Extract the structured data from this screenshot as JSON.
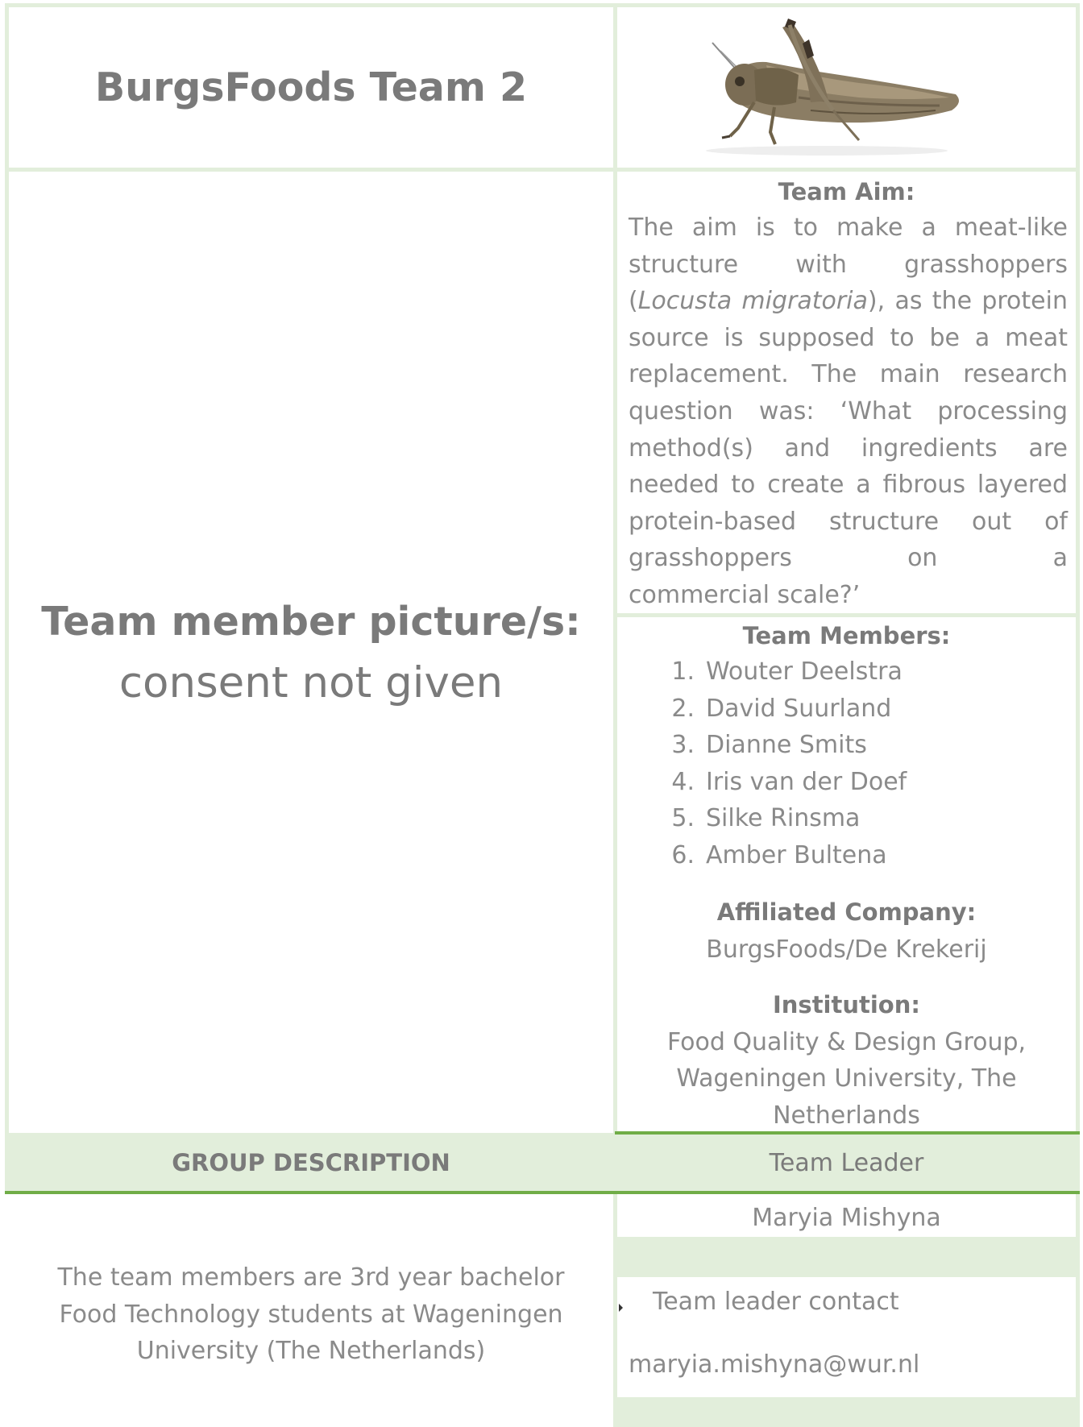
{
  "header": {
    "title": "BurgsFoods Team 2",
    "image_icon": "grasshopper-image"
  },
  "left_panel": {
    "picture_label": "Team member picture/s:",
    "picture_status": "consent not given"
  },
  "team_aim": {
    "heading": "Team Aim:",
    "text_before_italic": "The aim is to make a meat-like structure with grasshoppers (",
    "italic": "Locusta migratoria",
    "text_after_italic": "), as the protein source is supposed to be a meat replacement. The main research question was: ‘What processing method(s) and ingredients are needed to create a fibrous layered protein-based structure out of grasshoppers on a",
    "last_line": "commercial scale?’"
  },
  "team_members": {
    "heading": "Team Members:",
    "items": [
      {
        "num": "1.",
        "name": "Wouter Deelstra"
      },
      {
        "num": "2.",
        "name": "David Suurland"
      },
      {
        "num": "3.",
        "name": "Dianne Smits"
      },
      {
        "num": "4.",
        "name": "Iris van der Doef"
      },
      {
        "num": "5.",
        "name": "Silke Rinsma"
      },
      {
        "num": "6.",
        "name": "Amber Bultena"
      }
    ]
  },
  "affiliated_company": {
    "heading": "Affiliated Company:",
    "value": "BurgsFoods/De Krekerij"
  },
  "institution": {
    "heading": "Institution:",
    "line1": "Food Quality & Design Group,",
    "line2": "Wageningen University, The",
    "line3": "Netherlands"
  },
  "group_description": {
    "heading": "GROUP DESCRIPTION",
    "line1": "The team members are 3rd year bachelor",
    "line2": "Food Technology students at Wageningen",
    "line3": "University (The Netherlands)"
  },
  "team_leader": {
    "heading": "Team Leader",
    "name": "Maryia Mishyna",
    "contact_label": "Team leader contact",
    "email": "maryia.mishyna@wur.nl"
  },
  "colors": {
    "border": "#e2eedb",
    "accent_line": "#70ad47",
    "band": "#e2eedb",
    "text": "#7a7a7a"
  }
}
